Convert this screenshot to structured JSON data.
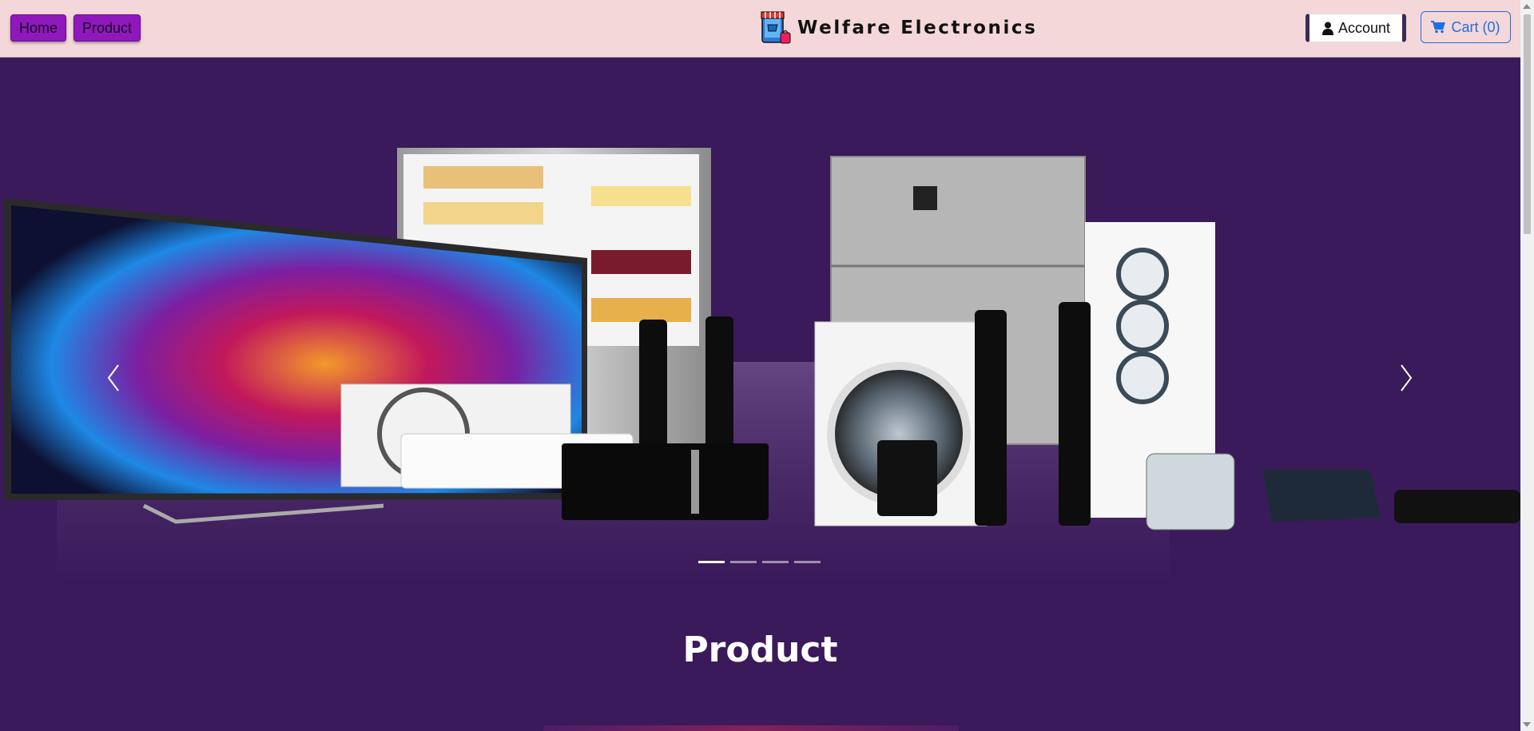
{
  "navbar": {
    "home_label": "Home",
    "product_label": "Product",
    "brand_name": "Welfare Electronics",
    "account_label": "Account",
    "cart_label": "Cart (0)"
  },
  "carousel": {
    "slide_count": 4,
    "active_index": 0,
    "prev_icon": "chevron-left-icon",
    "next_icon": "chevron-right-icon"
  },
  "section": {
    "title": "Product"
  },
  "colors": {
    "navbar_bg": "#f3d7d9",
    "nav_button": "#8f18bd",
    "page_bg": "#3a1a5a",
    "cart_accent": "#1f6fe0"
  }
}
